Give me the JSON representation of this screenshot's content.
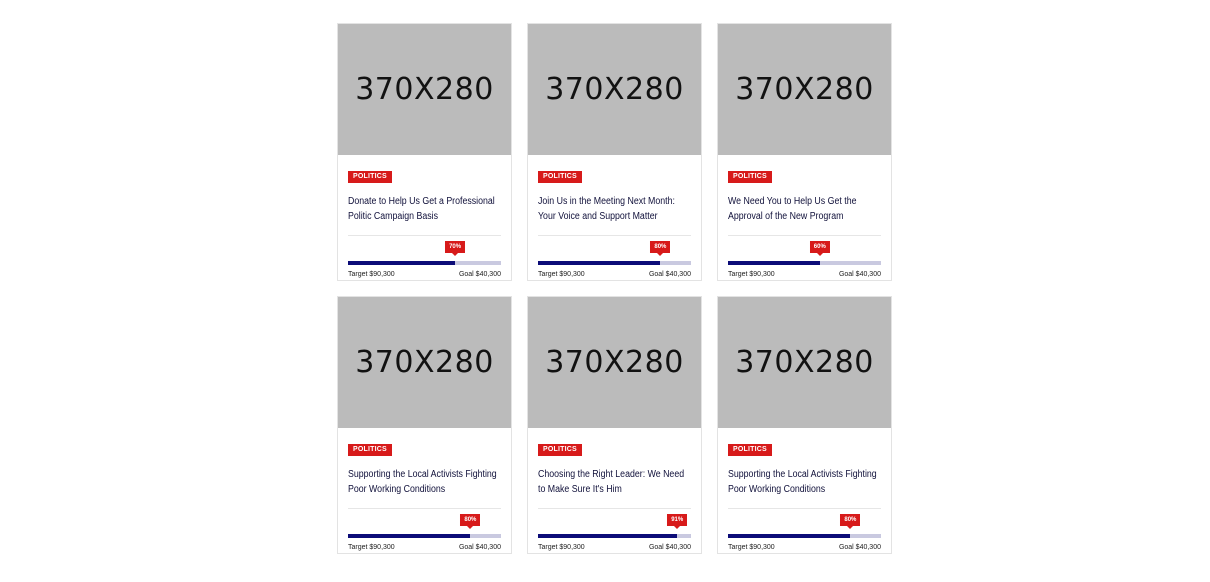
{
  "campaigns": [
    {
      "image_label": "370X280",
      "tag": "POLITICS",
      "title": "Donate to Help Us Get a Professional Politic Campaign Basis",
      "progress_label": "70%",
      "progress": 0.7,
      "target": "Target $90,300",
      "goal": "Goal $40,300"
    },
    {
      "image_label": "370X280",
      "tag": "POLITICS",
      "title": "Join Us in the Meeting Next Month: Your Voice and Support Matter",
      "progress_label": "80%",
      "progress": 0.8,
      "target": "Target $90,300",
      "goal": "Goal $40,300"
    },
    {
      "image_label": "370X280",
      "tag": "POLITICS",
      "title": "We Need You to Help Us Get the Approval of the New Program",
      "progress_label": "60%",
      "progress": 0.6,
      "target": "Target $90,300",
      "goal": "Goal $40,300"
    },
    {
      "image_label": "370X280",
      "tag": "POLITICS",
      "title": "Supporting the Local Activists Fighting Poor Working Conditions",
      "progress_label": "80%",
      "progress": 0.8,
      "target": "Target $90,300",
      "goal": "Goal $40,300"
    },
    {
      "image_label": "370X280",
      "tag": "POLITICS",
      "title": "Choosing the Right Leader: We Need to Make Sure It's Him",
      "progress_label": "91%",
      "progress": 0.91,
      "target": "Target $90,300",
      "goal": "Goal $40,300"
    },
    {
      "image_label": "370X280",
      "tag": "POLITICS",
      "title": "Supporting the Local Activists Fighting Poor Working Conditions",
      "progress_label": "80%",
      "progress": 0.8,
      "target": "Target $90,300",
      "goal": "Goal $40,300"
    }
  ],
  "colors": {
    "tag_bg": "#d71a1a",
    "progress_fill": "#0c0c78",
    "progress_track": "#c9c9e0",
    "placeholder_bg": "#bbbbbb"
  }
}
